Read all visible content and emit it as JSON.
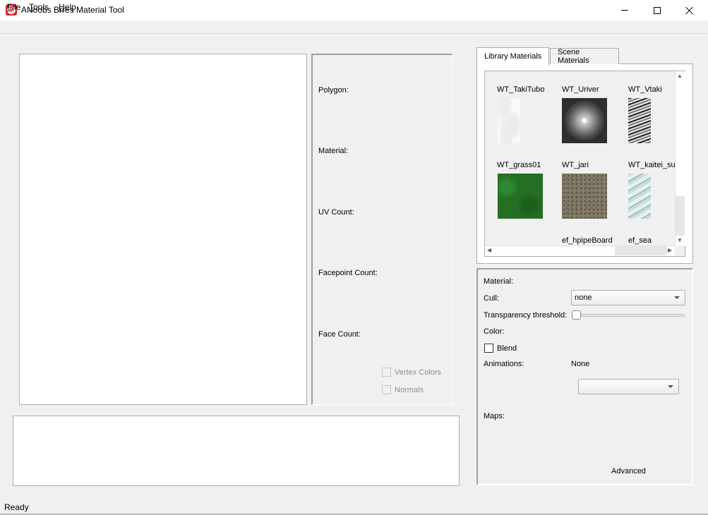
{
  "window": {
    "title": "ANoobs Brres Material Tool",
    "icon_glyph": "A",
    "controls": [
      "minimize",
      "maximize",
      "close"
    ]
  },
  "menu": {
    "items": [
      {
        "label_access": "F",
        "label_rest": "ile"
      },
      {
        "label_access": "T",
        "label_rest": "ools"
      },
      {
        "label_access": "H",
        "label_rest": "elp"
      }
    ]
  },
  "info_panel": {
    "polygon_label": "Polygon:",
    "material_label": "Material:",
    "uv_count_label": "UV Count:",
    "facepoint_count_label": "Facepoint Count:",
    "face_count_label": "Face Count:",
    "vertex_colors_label": "Vertex Colors",
    "normals_label": "Normals",
    "vertex_colors_checked": false,
    "normals_checked": false
  },
  "tabs": {
    "library": "Library Materials",
    "scene": "Scene Materials",
    "active": "Library Materials"
  },
  "library_materials": [
    {
      "name": "WT_TakiTubo",
      "thumb": "white-foam"
    },
    {
      "name": "WT_Uriver",
      "thumb": "radial-sphere"
    },
    {
      "name": "WT_Vtaki",
      "thumb": "waterfall-noise"
    },
    {
      "name": "WT_grass01",
      "thumb": "green-grass"
    },
    {
      "name": "WT_jari",
      "thumb": "gravel"
    },
    {
      "name": "WT_kaitei_sur",
      "thumb": "pale-blue-water"
    },
    {
      "name": "ef_hpipeBoard",
      "thumb": ""
    },
    {
      "name": "ef_sea",
      "thumb": ""
    }
  ],
  "properties": {
    "material_label": "Material:",
    "cull_label": "Cull:",
    "cull_value": "none",
    "transparency_label": "Transparency threshold:",
    "transparency_value": 0,
    "color_label": "Color:",
    "blend_label": "Blend",
    "blend_checked": false,
    "animations_label": "Animations:",
    "animations_value": "None",
    "animation_select_value": "",
    "maps_label": "Maps:",
    "advanced_label": "Advanced"
  },
  "status": {
    "text": "Ready"
  }
}
